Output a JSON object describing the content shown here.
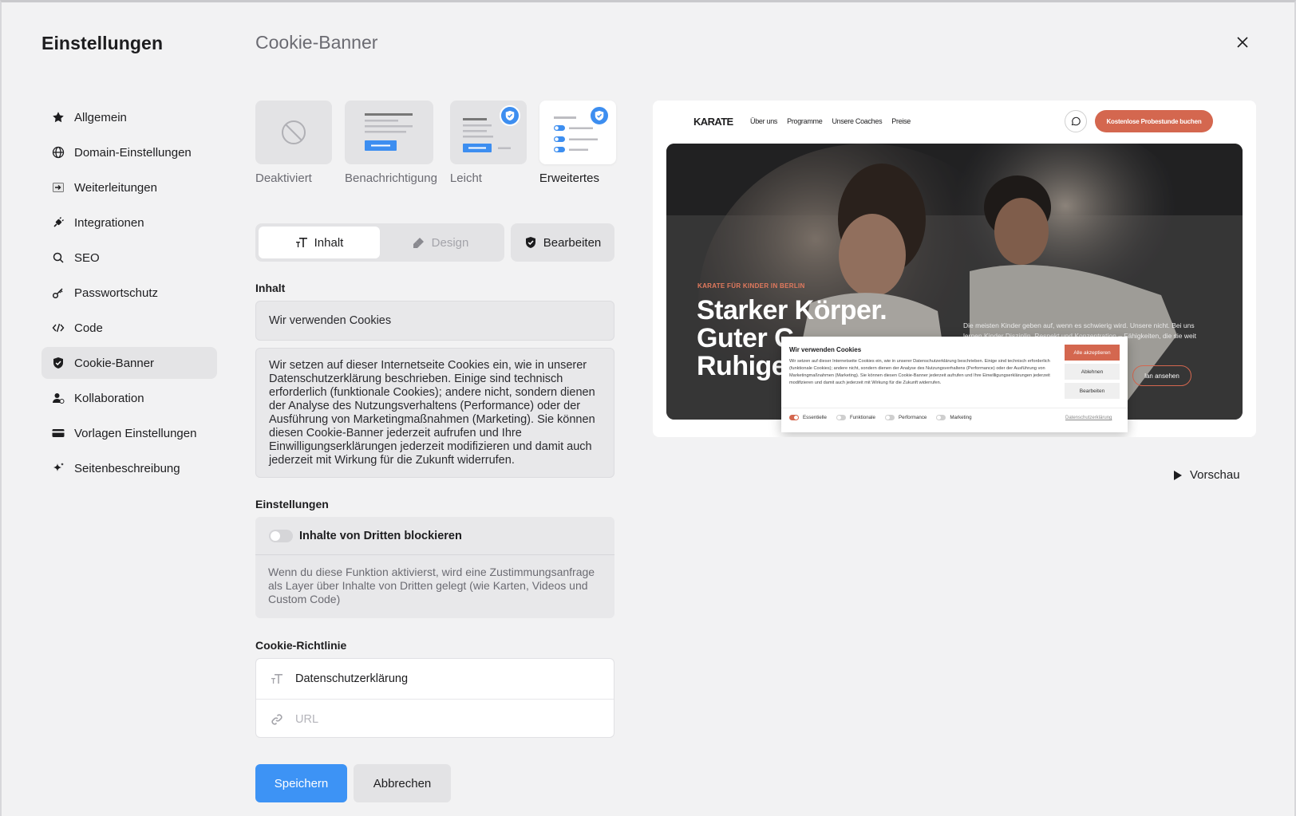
{
  "app": {
    "title": "Einstellungen"
  },
  "page": {
    "title": "Cookie-Banner"
  },
  "sidebar": {
    "items": [
      {
        "label": "Allgemein",
        "icon": "star-icon"
      },
      {
        "label": "Domain-Einstellungen",
        "icon": "globe-icon"
      },
      {
        "label": "Weiterleitungen",
        "icon": "redirect-icon"
      },
      {
        "label": "Integrationen",
        "icon": "plug-icon"
      },
      {
        "label": "SEO",
        "icon": "search-icon"
      },
      {
        "label": "Passwortschutz",
        "icon": "key-icon"
      },
      {
        "label": "Code",
        "icon": "code-icon"
      },
      {
        "label": "Cookie-Banner",
        "icon": "shield-check-icon",
        "active": true
      },
      {
        "label": "Kollaboration",
        "icon": "users-icon"
      },
      {
        "label": "Vorlagen Einstellungen",
        "icon": "card-icon"
      },
      {
        "label": "Seitenbeschreibung",
        "icon": "sparkle-icon"
      }
    ]
  },
  "banner_types": [
    {
      "label": "Deaktiviert",
      "selected": false
    },
    {
      "label": "Benachrichtigung",
      "selected": false
    },
    {
      "label": "Leicht",
      "selected": false,
      "checked": true
    },
    {
      "label": "Erweitertes",
      "selected": true,
      "checked": true
    }
  ],
  "tabs": [
    {
      "label": "Inhalt",
      "active": true
    },
    {
      "label": "Design",
      "active": false
    }
  ],
  "edit_button": {
    "label": "Bearbeiten"
  },
  "content": {
    "section_label": "Inhalt",
    "title_value": "Wir verwenden Cookies",
    "body_value": "Wir setzen auf dieser Internetseite Cookies ein, wie in unserer Datenschutzerklärung beschrieben. Einige sind technisch erforderlich (funktionale Cookies); andere nicht, sondern dienen der Analyse des Nutzungsverhaltens (Performance) oder der Ausführung von Marketingmaßnahmen (Marketing). Sie können diesen Cookie-Banner jederzeit aufrufen und Ihre Einwilligungserklärungen jederzeit modifizieren und damit auch jederzeit mit Wirkung für die Zukunft widerrufen."
  },
  "settings": {
    "section_label": "Einstellungen",
    "toggle_label": "Inhalte von Dritten blockieren",
    "toggle_on": false,
    "description": "Wenn du diese Funktion aktivierst, wird eine Zustimmungsanfrage als Layer über Inhalte von Dritten gelegt (wie Karten, Videos und Custom Code)"
  },
  "policy": {
    "section_label": "Cookie-Richtlinie",
    "link_text_value": "Datenschutzerklärung",
    "url_placeholder": "URL"
  },
  "actions": {
    "save": "Speichern",
    "cancel": "Abbrechen"
  },
  "preview": {
    "link_label": "Vorschau",
    "site": {
      "logo": "KARATE",
      "nav_links": [
        "Über uns",
        "Programme",
        "Unsere Coaches",
        "Preise"
      ],
      "cta": "Kostenlose Probestunde buchen",
      "eyebrow": "KARATE FÜR KINDER IN BERLIN",
      "headline_1": "Starker Körper.",
      "headline_2": "Guter C",
      "headline_3": "Ruhige",
      "side_text": "Die meisten Kinder geben auf, wenn es schwierig wird. Unsere nicht. Bei uns lernen Kinder Disziplin, Respekt und Konzentration – Fähigkeiten, die sie weit",
      "pill": "lan ansehen"
    },
    "cookie": {
      "title": "Wir verwenden Cookies",
      "text": "Wir setzen auf dieser Internetseite Cookies ein, wie in unserer Datenschutzerklärung beschrieben. Einige sind technisch erforderlich (funktionale Cookies); andere nicht, sondern dienen der Analyse des Nutzungsverhaltens (Performance) oder der Ausführung von Marketingmaßnahmen (Marketing). Sie können diesen Cookie-Banner jederzeit aufrufen und Ihre Einwilligungserklärungen jederzeit modifizieren und damit auch jederzeit mit Wirkung für die Zukunft widerrufen.",
      "accept": "Alle akzeptieren",
      "reject": "Ablehnen",
      "edit": "Bearbeiten",
      "categories": [
        {
          "label": "Essentielle",
          "on": true
        },
        {
          "label": "Funktionale",
          "on": false
        },
        {
          "label": "Performance",
          "on": false
        },
        {
          "label": "Marketing",
          "on": false
        }
      ],
      "privacy_link": "Datenschutzerklärung"
    }
  },
  "colors": {
    "accent": "#3d93f5",
    "brand_orange": "#d4674f",
    "active_bg": "#e4e4e6"
  }
}
